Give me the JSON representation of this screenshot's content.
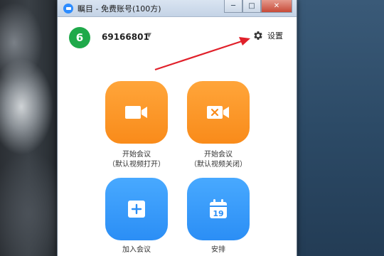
{
  "window": {
    "title": "瞩目 - 免费账号(100方)",
    "controls": {
      "minimize": "─",
      "maximize": "□",
      "close": "✕"
    }
  },
  "header": {
    "avatar_letter": "6",
    "account_id": "69166801",
    "caret": "▼",
    "settings_label": "设置"
  },
  "actions": [
    {
      "label": "开始会议",
      "sublabel": "（默认视频打开）",
      "icon": "video-camera-icon",
      "color": "#f98b1a"
    },
    {
      "label": "开始会议",
      "sublabel": "（默认视频关闭）",
      "icon": "video-camera-off-icon",
      "color": "#f98b1a"
    },
    {
      "label": "加入会议",
      "sublabel": "",
      "icon": "plus-icon",
      "color": "#2b8ef5"
    },
    {
      "label": "安排",
      "sublabel": "",
      "icon": "calendar-icon",
      "color": "#2b8ef5",
      "calendar_day": "19"
    }
  ],
  "annotation": {
    "arrow_color": "#e0202a"
  },
  "colors": {
    "avatar": "#1fa94a",
    "accent_orange": "#f98b1a",
    "accent_blue": "#2b8ef5"
  }
}
